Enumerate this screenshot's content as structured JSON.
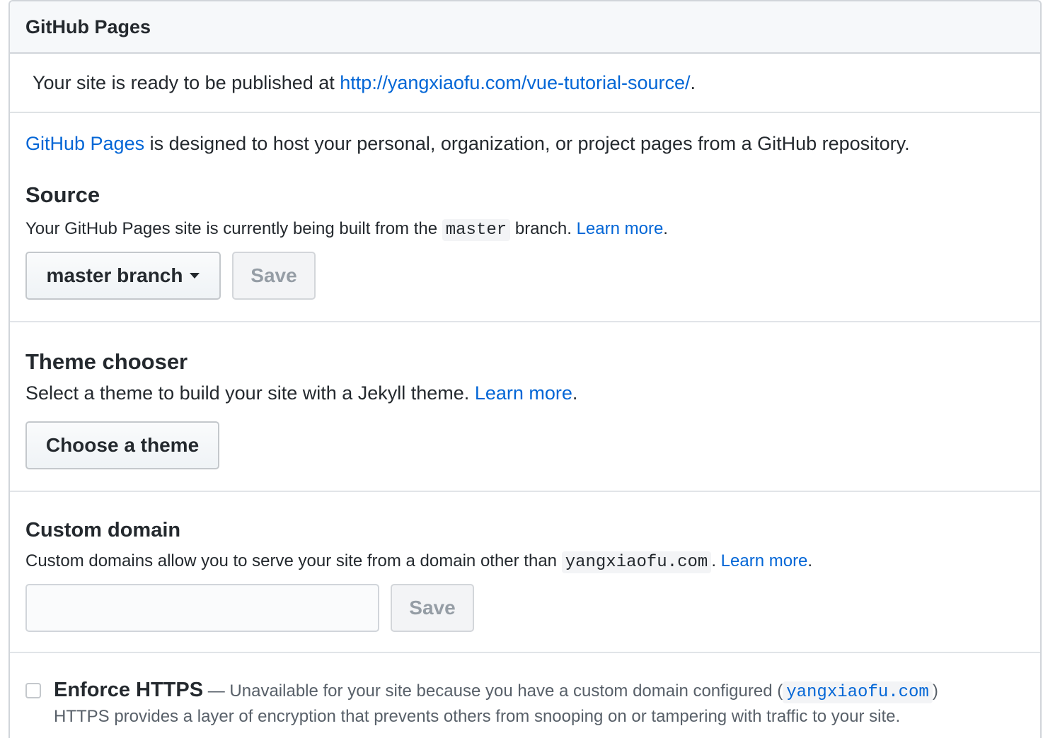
{
  "header": {
    "title": "GitHub Pages"
  },
  "flash": {
    "prefix": "Your site is ready to be published at ",
    "url": "http://yangxiaofu.com/vue-tutorial-source/",
    "suffix": "."
  },
  "intro": {
    "link": "GitHub Pages",
    "text": " is designed to host your personal, organization, or project pages from a GitHub repository."
  },
  "source": {
    "heading": "Source",
    "note_prefix": "Your GitHub Pages site is currently being built from the ",
    "branch_code": "master",
    "note_mid": " branch. ",
    "learn_more": "Learn more",
    "note_suffix": ".",
    "select_label": "master branch",
    "save_label": "Save"
  },
  "theme": {
    "heading": "Theme chooser",
    "note": "Select a theme to build your site with a Jekyll theme. ",
    "learn_more": "Learn more",
    "note_suffix": ".",
    "button_label": "Choose a theme"
  },
  "custom_domain": {
    "heading": "Custom domain",
    "note_prefix": "Custom domains allow you to serve your site from a domain other than ",
    "domain_code": "yangxiaofu.com",
    "note_mid": ". ",
    "learn_more": "Learn more",
    "note_suffix": ".",
    "input_value": "",
    "save_label": "Save"
  },
  "https": {
    "title": "Enforce HTTPS",
    "dash": " — Unavailable for your site because you have a custom domain configured (",
    "domain_code": "yangxiaofu.com",
    "close": ")",
    "description": "HTTPS provides a layer of encryption that prevents others from snooping on or tampering with traffic to your site."
  },
  "colors": {
    "link": "#0366d6",
    "border": "#d1d5da",
    "header_bg": "#f6f8fa"
  }
}
